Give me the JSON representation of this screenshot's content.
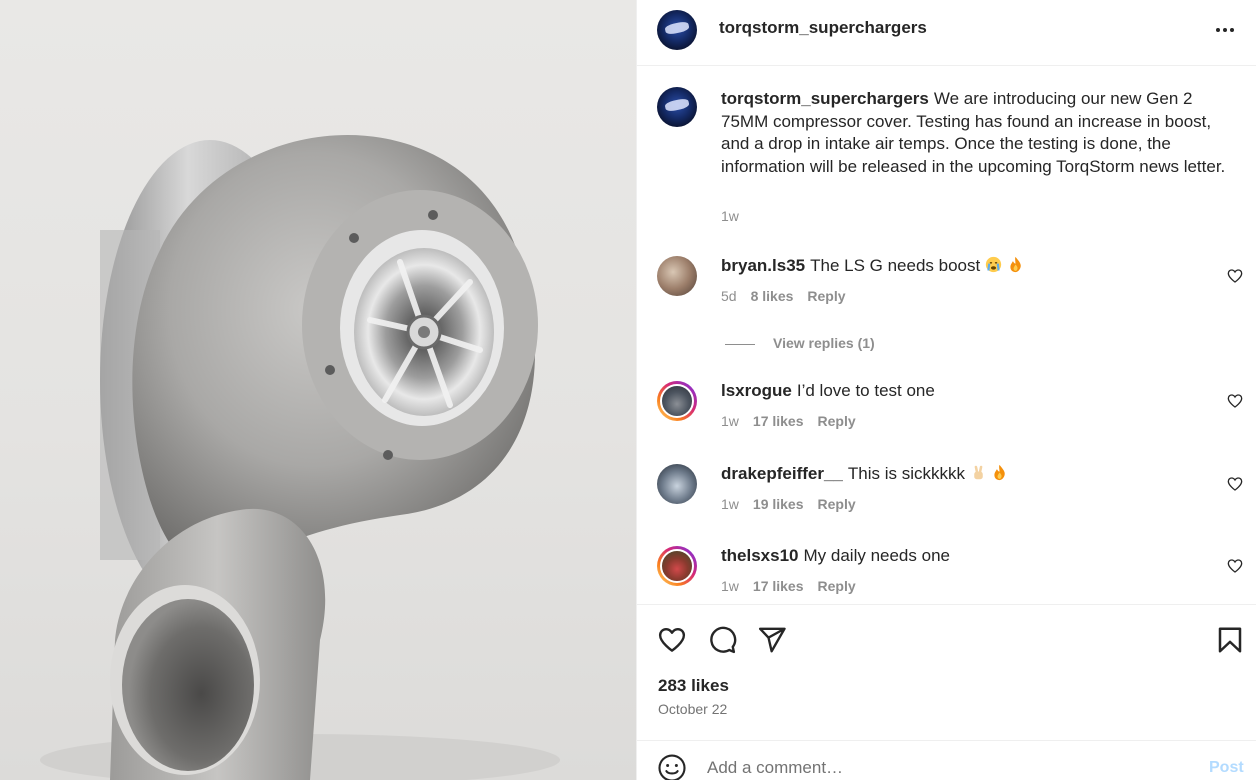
{
  "post": {
    "username": "torqstorm_superchargers",
    "photo_alt": "Gen 2 75MM compressor cover supercharger"
  },
  "caption": {
    "username": "torqstorm_superchargers",
    "text": "We are introducing our new Gen 2 75MM compressor cover. Testing has found an increase in boost, and a drop in intake air temps. Once the testing is done, the information will be released in the upcoming TorqStorm news letter.",
    "time": "1w"
  },
  "comments": [
    {
      "username": "bryan.ls35",
      "text": "The LS G needs boost",
      "emoji": [
        "crying-face",
        "fire"
      ],
      "time": "5d",
      "likes": "8 likes",
      "reply": "Reply"
    },
    {
      "username": "lsxrogue",
      "text": "I’d love to test one",
      "emoji": [],
      "time": "1w",
      "likes": "17 likes",
      "reply": "Reply"
    },
    {
      "username": "drakepfeiffer__",
      "text": "This is sickkkkk",
      "emoji": [
        "victory-hand",
        "fire"
      ],
      "time": "1w",
      "likes": "19 likes",
      "reply": "Reply"
    },
    {
      "username": "thelsxs10",
      "text": "My daily needs one",
      "emoji": [],
      "time": "1w",
      "likes": "17 likes",
      "reply": "Reply"
    }
  ],
  "view_replies": "View replies (1)",
  "actions": {
    "icons": [
      "heart-icon",
      "comment-icon",
      "share-icon",
      "bookmark-icon"
    ],
    "likes": "283 likes",
    "date": "October 22"
  },
  "add_comment": {
    "placeholder": "Add a comment…",
    "post_label": "Post"
  },
  "colors": {
    "text": "#262626",
    "secondary": "#8e8e8e",
    "post_button_disabled": "#b3dbff",
    "divider": "#efefef"
  }
}
